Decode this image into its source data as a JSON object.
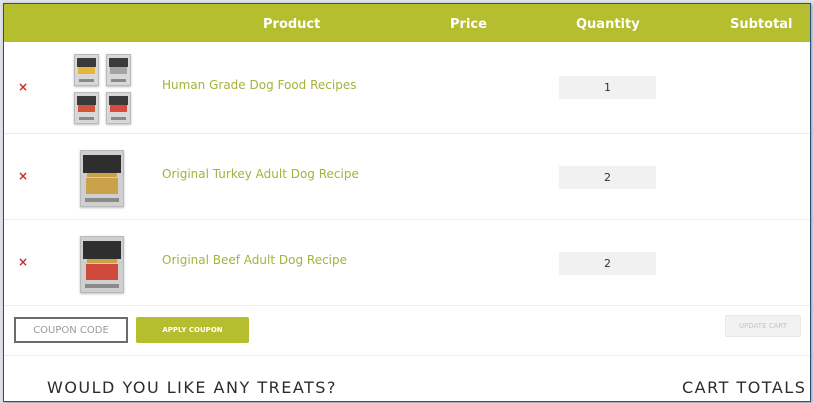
{
  "colors": {
    "accent": "#b5be2e",
    "product_link": "#a6b23a",
    "remove": "#cc2b2b",
    "heading": "#2f2c28"
  },
  "table": {
    "headers": {
      "product": "Product",
      "price": "Price",
      "quantity": "Quantity",
      "subtotal": "Subtotal"
    },
    "rows": [
      {
        "remove_icon": "×",
        "name": "Human Grade Dog Food Recipes",
        "quantity": "1",
        "thumbnail_icon": "product-bundle-image",
        "price": "",
        "subtotal": ""
      },
      {
        "remove_icon": "×",
        "name": "Original Turkey Adult Dog Recipe",
        "quantity": "2",
        "thumbnail_icon": "product-bag-image",
        "price": "",
        "subtotal": ""
      },
      {
        "remove_icon": "×",
        "name": "Original Beef Adult Dog Recipe",
        "quantity": "2",
        "thumbnail_icon": "product-bag-image",
        "price": "",
        "subtotal": ""
      }
    ]
  },
  "actions": {
    "coupon_placeholder": "COUPON CODE",
    "apply_label": "APPLY COUPON",
    "update_label": "UPDATE CART"
  },
  "sections": {
    "treats_heading": "WOULD YOU LIKE ANY TREATS?",
    "totals_heading": "CART TOTALS"
  }
}
